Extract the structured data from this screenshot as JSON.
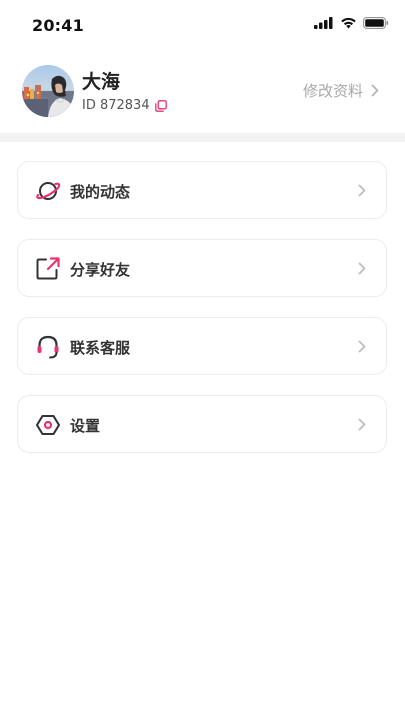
{
  "status_bar": {
    "time": "20:41"
  },
  "profile": {
    "nickname": "大海",
    "id_label": "ID 872834",
    "edit_label": "修改资料"
  },
  "menu": [
    {
      "label": "我的动态",
      "icon": "planet-icon"
    },
    {
      "label": "分享好友",
      "icon": "share-icon"
    },
    {
      "label": "联系客服",
      "icon": "headset-icon"
    },
    {
      "label": "设置",
      "icon": "hexagon-settings-icon"
    }
  ],
  "colors": {
    "accent": "#e8336d",
    "icon_dark": "#333333",
    "chevron": "#bdbdbd",
    "card_border": "#ececec",
    "divider": "#f3f3f3"
  }
}
